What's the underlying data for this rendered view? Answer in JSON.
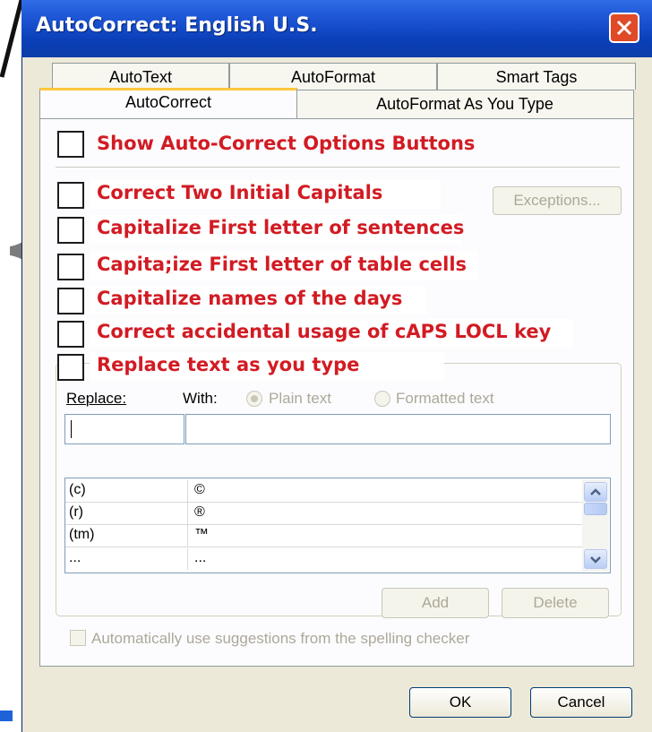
{
  "window": {
    "title": "AutoCorrect: English U.S."
  },
  "tabs": {
    "row1": [
      "AutoText",
      "AutoFormat",
      "Smart Tags"
    ],
    "row2": [
      "AutoCorrect",
      "AutoFormat As You Type"
    ]
  },
  "options": {
    "show_buttons": "Show Auto-Correct Options Buttons",
    "items": [
      "Correct Two Initial Capitals",
      "Capitalize First letter of sentences",
      "Capita;ize First letter of table cells",
      "Capitalize names of the days",
      "Correct accidental usage of cAPS LOCL key",
      "Replace text as you type"
    ],
    "exceptions_label": "Exceptions..."
  },
  "replace": {
    "replace_label": "Replace:",
    "with_label": "With:",
    "plain_text": "Plain text",
    "formatted_text": "Formatted text",
    "replace_value": "",
    "with_value": ""
  },
  "list": {
    "rows": [
      {
        "replace": "(c)",
        "with": "©"
      },
      {
        "replace": "(r)",
        "with": "®"
      },
      {
        "replace": "(tm)",
        "with": "™"
      },
      {
        "replace": "...",
        "with": "..."
      }
    ]
  },
  "actions": {
    "add": "Add",
    "delete": "Delete"
  },
  "spelling": {
    "label": "Automatically use suggestions from the spelling checker"
  },
  "footer": {
    "ok": "OK",
    "cancel": "Cancel"
  },
  "colors": {
    "accent_red": "#d21b23",
    "title_blue": "#0a3fb8",
    "tab_highlight": "#ffc83c"
  }
}
